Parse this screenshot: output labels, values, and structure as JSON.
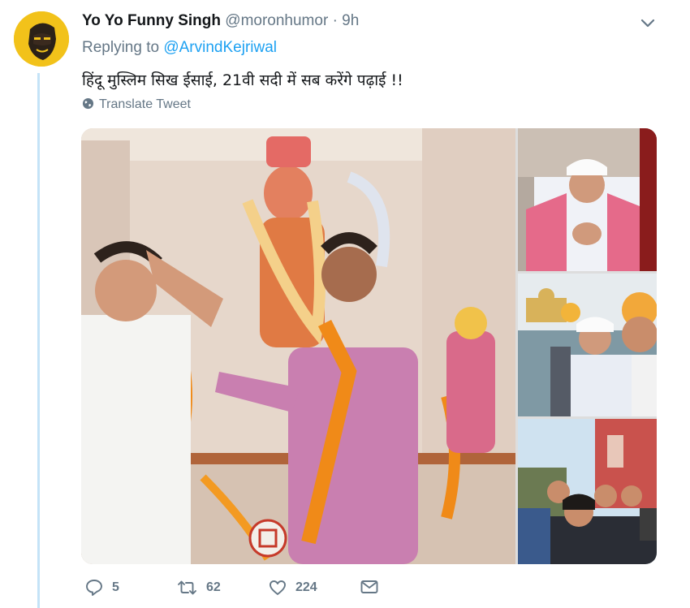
{
  "tweet": {
    "author_name": "Yo Yo Funny Singh",
    "handle": "@moronhumor",
    "separator": "·",
    "time": "9h",
    "replying_to_prefix": "Replying to",
    "replying_to_handle": "@ArvindKejriwal",
    "text": "हिंदू मुस्लिम सिख ईसाई, 21वी सदी में सब करेंगे पढ़ाई !!",
    "translate_label": "Translate Tweet"
  },
  "actions": {
    "replies": "5",
    "retweets": "62",
    "likes": "224"
  },
  "icons": {
    "avatar": "cartoon-face-avatar",
    "caret": "chevron-down-icon",
    "translate": "globe-icon",
    "reply": "reply-icon",
    "retweet": "retweet-icon",
    "like": "heart-icon",
    "dm": "envelope-icon"
  },
  "colors": {
    "link": "#1da1f2",
    "secondary_text": "#657786",
    "thread_line": "#c4e3f7",
    "avatar_bg": "#f2c21a"
  }
}
